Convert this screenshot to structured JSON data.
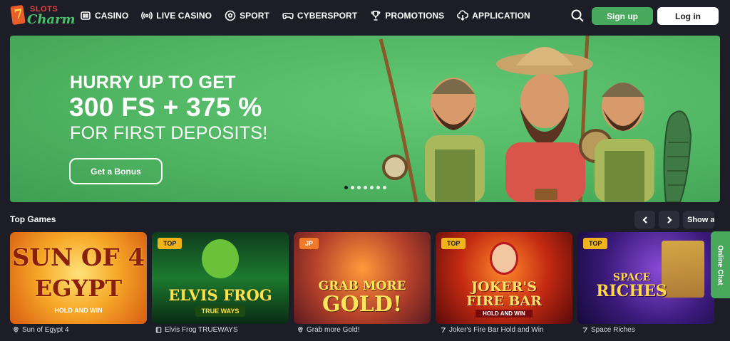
{
  "brand": {
    "logo_top": "SLOTS",
    "logo_bottom": "Charm"
  },
  "nav": [
    {
      "label": "CASINO",
      "icon": "casino-icon"
    },
    {
      "label": "LIVE CASINO",
      "icon": "live-broadcast-icon"
    },
    {
      "label": "SPORT",
      "icon": "soccer-ball-icon"
    },
    {
      "label": "CYBERSPORT",
      "icon": "gamepad-icon"
    },
    {
      "label": "PROMOTIONS",
      "icon": "trophy-icon"
    },
    {
      "label": "APPLICATION",
      "icon": "download-icon"
    }
  ],
  "header": {
    "signup": "Sign up",
    "login": "Log in"
  },
  "banner": {
    "line1": "HURRY UP TO GET",
    "line2": "300 FS + 375 %",
    "line3": "FOR FIRST DEPOSITS!",
    "button": "Get a Bonus",
    "slides": 7,
    "active_slide": 1
  },
  "top_games": {
    "title": "Top Games",
    "show_all": "Show all",
    "items": [
      {
        "name": "Sun of Egypt 4",
        "badge": "",
        "art_line1": "SUN OF 4",
        "art_line2": "EGYPT",
        "art_sub": "HOLD AND WIN",
        "provider_icon": "spiral-icon"
      },
      {
        "name": "Elvis Frog TRUEWAYS",
        "badge": "TOP",
        "art_line1": "ELVIS FROG",
        "art_line2": "TRUE WAYS",
        "art_sub": "",
        "provider_icon": "book-icon"
      },
      {
        "name": "Grab more Gold!",
        "badge": "JP",
        "art_line1": "GRAB MORE",
        "art_line2": "GOLD!",
        "art_sub": "",
        "provider_icon": "spiral-icon"
      },
      {
        "name": "Joker's Fire Bar Hold and Win",
        "badge": "TOP",
        "art_line1": "JOKER'S",
        "art_line2": "FIRE BAR",
        "art_sub": "HOLD AND WIN",
        "provider_icon": "seven-icon"
      },
      {
        "name": "Space Riches",
        "badge": "TOP",
        "art_line1": "SPACE",
        "art_line2": "RICHES",
        "art_sub": "",
        "provider_icon": "seven-icon"
      }
    ]
  },
  "online_chat": "Online Chat",
  "colors": {
    "background": "#1c1d26",
    "accent_green": "#48a85c",
    "banner_green": "#4fb562",
    "badge_yellow": "#f0b31a"
  }
}
